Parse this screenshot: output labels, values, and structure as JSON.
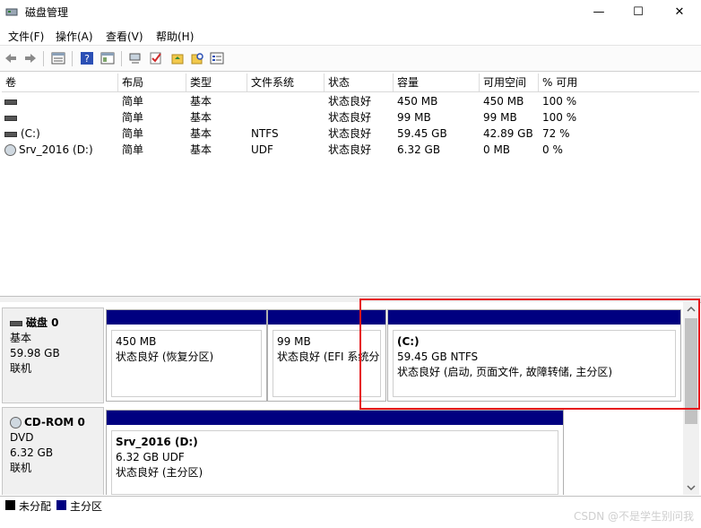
{
  "window": {
    "title": "磁盘管理",
    "minimize": "—",
    "maximize": "☐",
    "close": "✕"
  },
  "menu": [
    "文件(F)",
    "操作(A)",
    "查看(V)",
    "帮助(H)"
  ],
  "toolbar": {
    "icons": [
      "back-icon",
      "forward-icon",
      "list-view-icon",
      "help-icon",
      "properties-icon",
      "connect-icon",
      "check-icon",
      "folder-up-icon",
      "search-folder-icon",
      "window-list-icon"
    ]
  },
  "volume_table": {
    "columns": [
      "卷",
      "布局",
      "类型",
      "文件系统",
      "状态",
      "容量",
      "可用空间",
      "% 可用"
    ],
    "rows": [
      {
        "volume": "",
        "icon": "drive-icon",
        "layout": "简单",
        "type": "基本",
        "fs": "",
        "status": "状态良好",
        "capacity": "450 MB",
        "free": "450 MB",
        "pct": "100 %"
      },
      {
        "volume": "",
        "icon": "drive-icon",
        "layout": "简单",
        "type": "基本",
        "fs": "",
        "status": "状态良好",
        "capacity": "99 MB",
        "free": "99 MB",
        "pct": "100 %"
      },
      {
        "volume": "(C:)",
        "icon": "drive-icon",
        "layout": "简单",
        "type": "基本",
        "fs": "NTFS",
        "status": "状态良好",
        "capacity": "59.45 GB",
        "free": "42.89 GB",
        "pct": "72 %"
      },
      {
        "volume": "Srv_2016 (D:)",
        "icon": "cd-icon",
        "layout": "简单",
        "type": "基本",
        "fs": "UDF",
        "status": "状态良好",
        "capacity": "6.32 GB",
        "free": "0 MB",
        "pct": "0 %"
      }
    ]
  },
  "disks": [
    {
      "name": "磁盘 0",
      "kind": "基本",
      "size": "59.98 GB",
      "state": "联机",
      "partitions": [
        {
          "title": "",
          "size": "450 MB",
          "status": "状态良好 (恢复分区)"
        },
        {
          "title": "",
          "size": "99 MB",
          "status": "状态良好 (EFI 系统分区)"
        },
        {
          "title": "(C:)",
          "size": "59.45 GB NTFS",
          "status": "状态良好 (启动, 页面文件, 故障转储, 主分区)"
        }
      ]
    },
    {
      "name": "CD-ROM 0",
      "kind": "DVD",
      "size": "6.32 GB",
      "state": "联机",
      "partitions": [
        {
          "title": "Srv_2016  (D:)",
          "size": "6.32 GB UDF",
          "status": "状态良好 (主分区)"
        }
      ]
    }
  ],
  "legend": [
    {
      "label": "未分配",
      "color": "#000000"
    },
    {
      "label": "主分区",
      "color": "#000080"
    }
  ],
  "highlight_color": "#e6161a",
  "watermark": "CSDN @不是学生别问我"
}
